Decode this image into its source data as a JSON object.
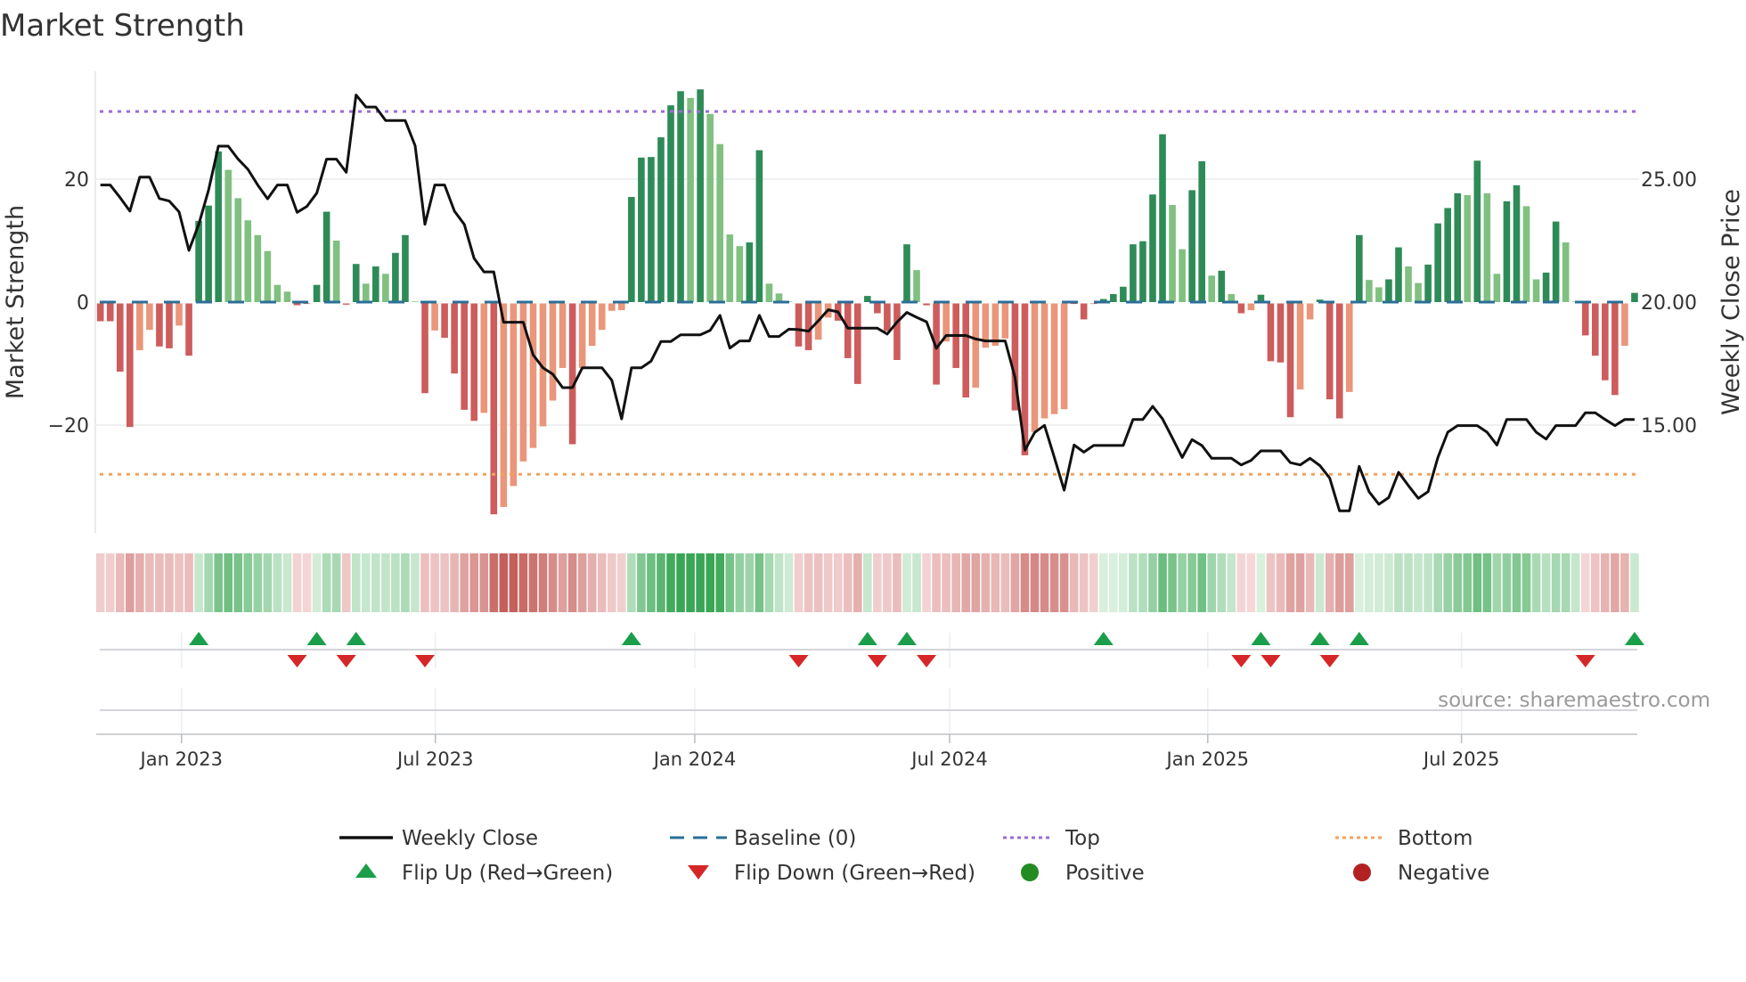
{
  "chart_data": {
    "type": "bar",
    "title": "Market Strength",
    "ylabel": "Market Strength",
    "y2label": "Weekly Close Price",
    "source": "source: sharemaestro.com",
    "ylim": [
      -38,
      38.5
    ],
    "y2lim": [
      10.5,
      29.6
    ],
    "y_ticks": [
      {
        "value": 20,
        "label": "20"
      },
      {
        "value": 0,
        "label": "0"
      },
      {
        "value": -20,
        "label": "−20"
      }
    ],
    "y2_ticks": [
      {
        "value": 25,
        "label": "25.00"
      },
      {
        "value": 20,
        "label": "20.00"
      },
      {
        "value": 15,
        "label": "15.00"
      }
    ],
    "x_unit": "week index (weekly bars, first bar ≈ early Nov 2022)",
    "x_ticks": [
      {
        "week": 9.25,
        "label": "Jan 2023"
      },
      {
        "week": 35.06,
        "label": "Jul 2023"
      },
      {
        "week": 61.44,
        "label": "Jan 2024"
      },
      {
        "week": 87.35,
        "label": "Jul 2024"
      },
      {
        "week": 113.6,
        "label": "Jan 2025"
      },
      {
        "week": 139.4,
        "label": "Jul 2025"
      }
    ],
    "top_level": 31,
    "bottom_level": -28,
    "baseline": 0,
    "strength": [
      -2.9,
      -2.9,
      -11.1,
      -20.1,
      -7.6,
      -4.3,
      -7.0,
      -7.3,
      -3.6,
      -8.5,
      13.2,
      15.7,
      24.5,
      21.5,
      16.9,
      13.3,
      10.9,
      8.3,
      2.8,
      1.7,
      -0.3,
      0,
      2.8,
      14.7,
      10.0,
      -0.2,
      6.2,
      3.0,
      5.8,
      4.6,
      8.0,
      10.9,
      0.1,
      -14.6,
      -4.4,
      -5.6,
      -11.4,
      -17.3,
      -19.1,
      -17.8,
      -34.3,
      -33.1,
      -29.7,
      -25.7,
      -23.5,
      -20.0,
      -15.8,
      -10.5,
      -22.9,
      -10.5,
      -6.9,
      -4.3,
      -1.2,
      -1.1,
      17.1,
      23.5,
      23.6,
      26.8,
      32.0,
      34.3,
      33.2,
      34.6,
      30.6,
      25.7,
      11.0,
      9.1,
      9.7,
      24.7,
      3.0,
      1.4,
      0.1,
      -7.0,
      -7.6,
      -5.9,
      -2.3,
      -2.8,
      -8.9,
      -13.1,
      1.0,
      -1.6,
      -4.5,
      -9.2,
      9.4,
      5.2,
      -0.3,
      -13.2,
      -6.2,
      -10.5,
      -15.3,
      -13.7,
      -7.2,
      -6.9,
      -5.7,
      -17.4,
      -24.7,
      -20.9,
      -18.7,
      -18.0,
      -17.2,
      0,
      -2.6,
      0,
      0.5,
      1.3,
      2.5,
      9.4,
      9.9,
      17.5,
      27.3,
      15.8,
      8.6,
      18.2,
      22.9,
      4.3,
      5.1,
      1.3,
      -1.6,
      -1.1,
      1.2,
      -9.4,
      -9.6,
      -18.5,
      -14.0,
      -2.6,
      0.4,
      -15.6,
      -18.7,
      -14.4,
      10.9,
      3.6,
      2.4,
      3.7,
      8.9,
      5.8,
      3.1,
      6.1,
      12.8,
      15.3,
      17.7,
      17.4,
      23.0,
      17.7,
      4.6,
      16.4,
      19.0,
      15.6,
      3.7,
      4.8,
      13.1,
      9.7,
      0.1,
      -5.2,
      -8.5,
      -12.5,
      -14.9,
      -6.9,
      1.5
    ],
    "weekly_close": [
      24.76,
      24.76,
      24.25,
      23.7,
      25.08,
      25.08,
      24.21,
      24.11,
      23.67,
      22.1,
      23.16,
      24.55,
      26.34,
      26.34,
      25.81,
      25.4,
      24.76,
      24.2,
      24.76,
      24.76,
      23.65,
      23.89,
      24.43,
      25.81,
      25.81,
      25.28,
      28.42,
      27.93,
      27.93,
      27.38,
      27.38,
      27.38,
      26.36,
      23.16,
      24.76,
      24.76,
      23.7,
      23.16,
      21.78,
      21.23,
      21.23,
      19.18,
      19.18,
      19.18,
      17.85,
      17.33,
      17.07,
      16.52,
      16.52,
      17.33,
      17.33,
      17.33,
      16.82,
      15.25,
      17.33,
      17.33,
      17.6,
      18.4,
      18.4,
      18.67,
      18.67,
      18.67,
      18.85,
      19.46,
      18.13,
      18.42,
      18.42,
      19.46,
      18.6,
      18.6,
      18.9,
      18.88,
      18.82,
      19.24,
      19.69,
      19.6,
      18.94,
      18.94,
      18.94,
      18.94,
      18.7,
      19.18,
      19.58,
      19.38,
      19.2,
      18.12,
      18.64,
      18.64,
      18.64,
      18.5,
      18.42,
      18.42,
      18.42,
      16.94,
      13.98,
      14.7,
      14.99,
      13.68,
      12.35,
      14.19,
      13.9,
      14.17,
      14.17,
      14.17,
      14.17,
      15.23,
      15.23,
      15.76,
      15.25,
      14.47,
      13.68,
      14.41,
      14.17,
      13.65,
      13.65,
      13.65,
      13.38,
      13.56,
      13.95,
      13.95,
      13.95,
      13.47,
      13.38,
      13.65,
      13.35,
      12.84,
      11.51,
      11.51,
      13.32,
      12.29,
      11.78,
      12.05,
      13.08,
      12.54,
      12.02,
      12.29,
      13.68,
      14.71,
      14.98,
      14.98,
      14.98,
      14.71,
      14.19,
      15.23,
      15.23,
      15.23,
      14.71,
      14.43,
      14.98,
      14.98,
      14.98,
      15.5,
      15.5,
      15.23,
      14.98,
      15.23,
      15.23
    ],
    "flip_up_weeks": [
      11,
      23,
      27,
      55,
      79,
      83,
      103,
      119,
      125,
      129,
      157
    ],
    "flip_down_weeks": [
      21,
      26,
      34,
      72,
      80,
      85,
      117,
      120,
      126,
      152
    ],
    "colors": {
      "pos_strong": "#2e8b57",
      "pos_weak": "#80c080",
      "neg_strong": "#cd5c5c",
      "neg_weak": "#e9967a",
      "line": "#111111",
      "baseline": "#2a6f97",
      "top": "#9b6bd6",
      "bottom": "#f0a35e",
      "flip_up": "#1a9e4a",
      "flip_down": "#d62728",
      "positive": "#228b22",
      "negative": "#b22222"
    },
    "legend": {
      "placement": "bottom",
      "items": [
        {
          "label": "Weekly Close",
          "kind": "line"
        },
        {
          "label": "Baseline (0)",
          "kind": "dash"
        },
        {
          "label": "Top",
          "kind": "dot-top"
        },
        {
          "label": "Bottom",
          "kind": "dot-bottom"
        },
        {
          "label": "Flip Up (Red→Green)",
          "kind": "tri-up"
        },
        {
          "label": "Flip Down (Green→Red)",
          "kind": "tri-down"
        },
        {
          "label": "Positive",
          "kind": "dot-pos"
        },
        {
          "label": "Negative",
          "kind": "dot-neg"
        }
      ]
    }
  }
}
